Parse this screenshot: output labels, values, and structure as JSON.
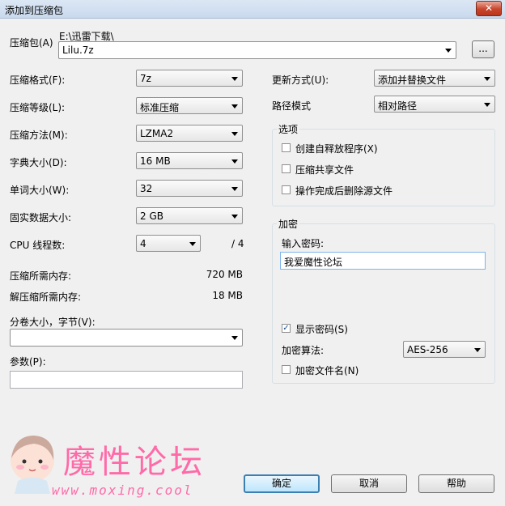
{
  "window": {
    "title": "添加到压缩包",
    "close_glyph": "✕"
  },
  "archive": {
    "label": "压缩包(A)",
    "path": "E:\\迅雷下载\\",
    "name": "Lilu.7z",
    "browse_label": "..."
  },
  "left": {
    "format": {
      "label": "压缩格式(F):",
      "value": "7z"
    },
    "level": {
      "label": "压缩等级(L):",
      "value": "标准压缩"
    },
    "method": {
      "label": "压缩方法(M):",
      "value": "LZMA2"
    },
    "dict": {
      "label": "字典大小(D):",
      "value": "16 MB"
    },
    "word": {
      "label": "单词大小(W):",
      "value": "32"
    },
    "solid": {
      "label": "固实数据大小:",
      "value": "2 GB"
    },
    "threads": {
      "label": "CPU 线程数:",
      "value": "4",
      "max": "/ 4"
    },
    "mem_compress": {
      "label": "压缩所需内存:",
      "value": "720 MB"
    },
    "mem_decompress": {
      "label": "解压缩所需内存:",
      "value": "18 MB"
    },
    "volume": {
      "label": "分卷大小，字节(V):",
      "value": ""
    },
    "params": {
      "label": "参数(P):",
      "value": ""
    }
  },
  "right": {
    "update": {
      "label": "更新方式(U):",
      "value": "添加并替换文件"
    },
    "path_mode": {
      "label": "路径模式",
      "value": "相对路径"
    },
    "options": {
      "title": "选项",
      "items": [
        {
          "label": "创建自释放程序(X)",
          "checked": false
        },
        {
          "label": "压缩共享文件",
          "checked": false
        },
        {
          "label": "操作完成后删除源文件",
          "checked": false
        }
      ]
    },
    "encryption": {
      "title": "加密",
      "password_label": "输入密码:",
      "password_value": "我爱魔性论坛",
      "show_password": {
        "label": "显示密码(S)",
        "checked": true
      },
      "method_label": "加密算法:",
      "method_value": "AES-256",
      "encrypt_names": {
        "label": "加密文件名(N)",
        "checked": false
      }
    }
  },
  "buttons": {
    "ok": "确定",
    "cancel": "取消",
    "help": "帮助"
  },
  "watermark": {
    "text": "魔性论坛",
    "url": "www.moxing.cool"
  }
}
